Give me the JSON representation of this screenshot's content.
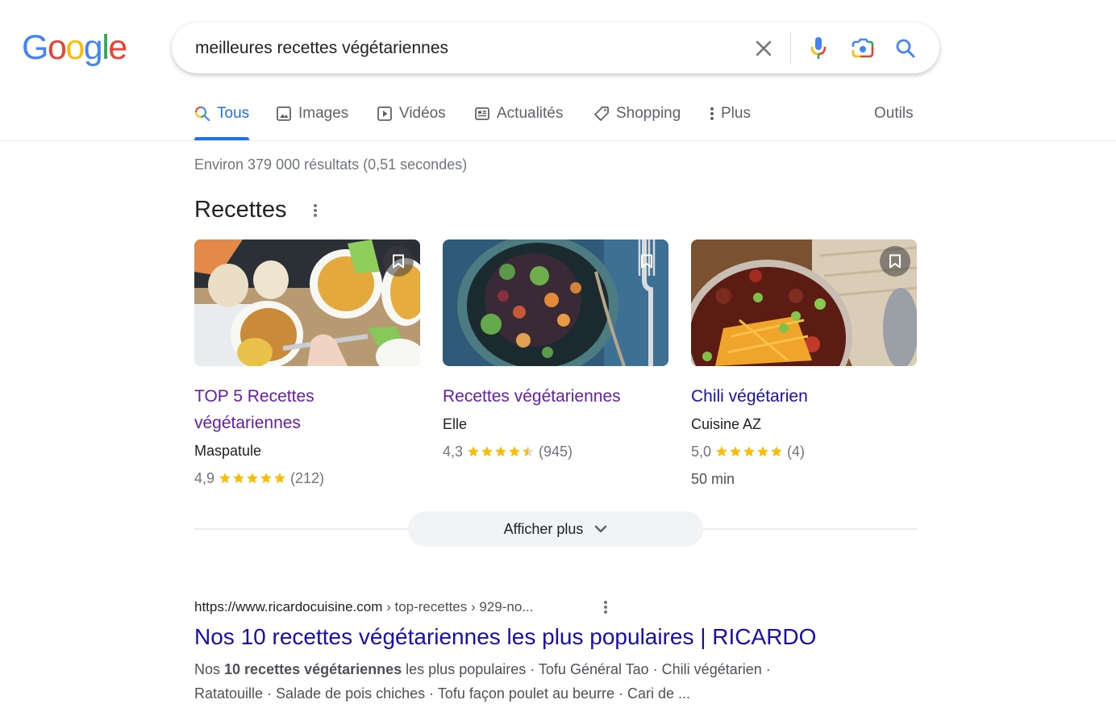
{
  "header": {
    "logo": [
      "G",
      "o",
      "o",
      "g",
      "l",
      "e"
    ],
    "logo_colors": [
      "#4285f4",
      "#ea4335",
      "#fbbc05",
      "#4285f4",
      "#34a853",
      "#ea4335"
    ],
    "search_query": "meilleures recettes végétariennes"
  },
  "tabs": [
    {
      "label": "Tous",
      "icon": "search-icon",
      "active": true
    },
    {
      "label": "Images",
      "icon": "image-icon"
    },
    {
      "label": "Vidéos",
      "icon": "play-icon"
    },
    {
      "label": "Actualités",
      "icon": "news-icon"
    },
    {
      "label": "Shopping",
      "icon": "tag-icon"
    },
    {
      "label": "Plus",
      "icon": "more-vert-icon"
    }
  ],
  "tools_label": "Outils",
  "result_stats": "Environ 379 000 résultats (0,51 secondes)",
  "recipes": {
    "heading": "Recettes",
    "cards": [
      {
        "title": "TOP 5 Recettes végétariennes",
        "source": "Maspatule",
        "rating": "4,9",
        "rating_value": 4.9,
        "reviews": "(212)",
        "time": ""
      },
      {
        "title": "Recettes végétariennes",
        "source": "Elle",
        "rating": "4,3",
        "rating_value": 4.3,
        "reviews": "(945)",
        "time": ""
      },
      {
        "title": "Chili végétarien",
        "source": "Cuisine AZ",
        "rating": "5,0",
        "rating_value": 5.0,
        "reviews": "(4)",
        "time": "50 min"
      }
    ],
    "show_more_label": "Afficher plus"
  },
  "result": {
    "url_domain": "https://www.ricardocuisine.com",
    "url_crumbs": " › top-recettes › 929-no...",
    "title": "Nos 10 recettes végétariennes les plus populaires | RICARDO",
    "snippet_prefix": "Nos ",
    "snippet_bold": "10 recettes végétariennes",
    "snippet_rest": " les plus populaires · Tofu Général Tao · Chili végétarien · Ratatouille · Salade de pois chiches · Tofu façon poulet au beurre · Cari de ..."
  },
  "colors": {
    "accent": "#1a73e8",
    "link_visited": "#681da8",
    "link": "#1a0dab",
    "star": "#fbbc04"
  }
}
